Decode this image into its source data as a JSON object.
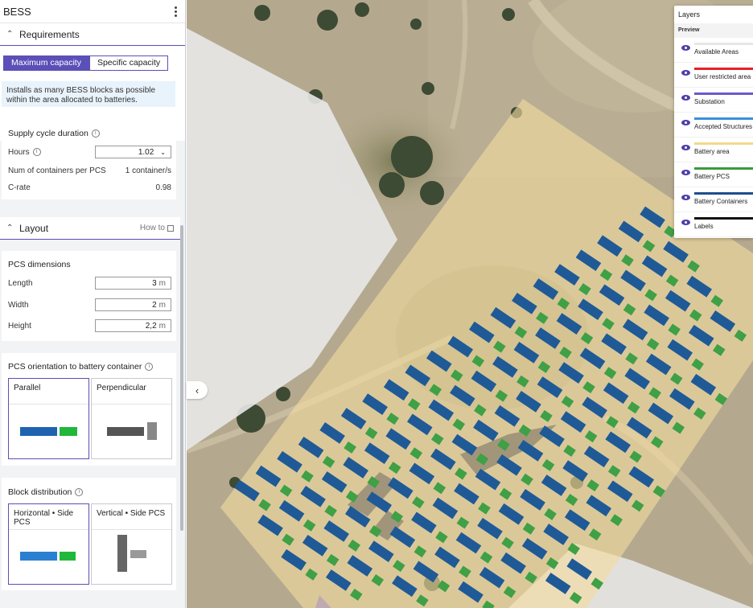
{
  "panel": {
    "title": "BESS",
    "requirements": {
      "title": "Requirements",
      "mode_active": "Maximum capacity",
      "mode_inactive": "Specific capacity",
      "info": "Installs as many BESS blocks as possible within the area allocated to batteries.",
      "supply_cycle_title": "Supply cycle duration",
      "hours_label": "Hours",
      "hours_value": "1.02",
      "containers_label": "Num of containers per PCS",
      "containers_value": "1 container/s",
      "crate_label": "C-rate",
      "crate_value": "0.98"
    },
    "layout": {
      "title": "Layout",
      "howto": "How to",
      "pcs_dimensions_title": "PCS dimensions",
      "length_label": "Length",
      "length_value": "3",
      "width_label": "Width",
      "width_value": "2",
      "height_label": "Height",
      "height_value": "2,2",
      "unit": "m",
      "orientation_title": "PCS orientation to battery container",
      "orientation_options": [
        "Parallel",
        "Perpendicular"
      ],
      "distribution_title": "Block distribution",
      "distribution_options": [
        "Horizontal • Side PCS",
        "Vertical • Side PCS"
      ]
    }
  },
  "map": {
    "collapse_icon": "chevron-left-icon"
  },
  "layers": {
    "title": "Layers",
    "preview": "Preview",
    "items": [
      {
        "name": "Available Areas",
        "color": "#e6e6e6"
      },
      {
        "name": "User restricted area",
        "color": "#e8202a"
      },
      {
        "name": "Substation",
        "color": "#6a5acd"
      },
      {
        "name": "Accepted Structures",
        "color": "#3a8fd8"
      },
      {
        "name": "Battery area",
        "color": "#f1d98c"
      },
      {
        "name": "Battery PCS",
        "color": "#3c9a3c"
      },
      {
        "name": "Battery Containers",
        "color": "#1f4e8c"
      },
      {
        "name": "Labels",
        "color": "#111111"
      }
    ]
  },
  "colors": {
    "accent": "#5b4fb8",
    "container": "#1f5a96",
    "pcs": "#3fa046",
    "battery_area": "#f3deа0"
  }
}
